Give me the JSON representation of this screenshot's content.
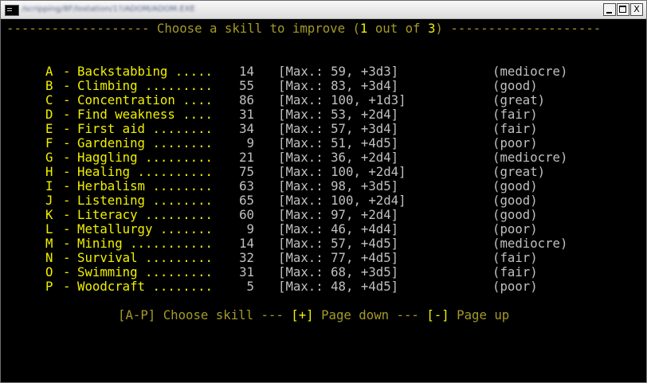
{
  "window": {
    "title": "/scripping/8F/lostation/1?/ADOM/ADOM.EXE",
    "buttons": {
      "minimize": "_",
      "maximize": "□",
      "close": "X"
    }
  },
  "header": {
    "dashes_left": "-------------------",
    "prompt": "Choose a skill to improve (",
    "current": "1",
    "out_of": "out of",
    "total": "3",
    "close_paren": ")",
    "dashes_right": "--------------------"
  },
  "skills": [
    {
      "key": "A",
      "dots": "Backstabbing .....",
      "value": "14",
      "max": "[Max.: 59, +3d3]",
      "rating": "(mediocre)"
    },
    {
      "key": "B",
      "dots": "Climbing .........",
      "value": "55",
      "max": "[Max.: 83, +3d4]",
      "rating": "(good)"
    },
    {
      "key": "C",
      "dots": "Concentration ....",
      "value": "86",
      "max": "[Max.: 100, +1d3]",
      "rating": "(great)"
    },
    {
      "key": "D",
      "dots": "Find weakness ....",
      "value": "31",
      "max": "[Max.: 53, +2d4]",
      "rating": "(fair)"
    },
    {
      "key": "E",
      "dots": "First aid ........",
      "value": "34",
      "max": "[Max.: 57, +3d4]",
      "rating": "(fair)"
    },
    {
      "key": "F",
      "dots": "Gardening ........",
      "value": "9",
      "max": "[Max.: 51, +4d5]",
      "rating": "(poor)"
    },
    {
      "key": "G",
      "dots": "Haggling .........",
      "value": "21",
      "max": "[Max.: 36, +2d4]",
      "rating": "(mediocre)"
    },
    {
      "key": "H",
      "dots": "Healing ..........",
      "value": "75",
      "max": "[Max.: 100, +2d4]",
      "rating": "(great)"
    },
    {
      "key": "I",
      "dots": "Herbalism ........",
      "value": "63",
      "max": "[Max.: 98, +3d5]",
      "rating": "(good)"
    },
    {
      "key": "J",
      "dots": "Listening ........",
      "value": "65",
      "max": "[Max.: 100, +2d4]",
      "rating": "(good)"
    },
    {
      "key": "K",
      "dots": "Literacy .........",
      "value": "60",
      "max": "[Max.: 97, +2d4]",
      "rating": "(good)"
    },
    {
      "key": "L",
      "dots": "Metallurgy .......",
      "value": "9",
      "max": "[Max.: 46, +4d4]",
      "rating": "(poor)"
    },
    {
      "key": "M",
      "dots": "Mining ...........",
      "value": "14",
      "max": "[Max.: 57, +4d5]",
      "rating": "(mediocre)"
    },
    {
      "key": "N",
      "dots": "Survival .........",
      "value": "32",
      "max": "[Max.: 77, +4d5]",
      "rating": "(fair)"
    },
    {
      "key": "O",
      "dots": "Swimming .........",
      "value": "31",
      "max": "[Max.: 68, +3d5]",
      "rating": "(fair)"
    },
    {
      "key": "P",
      "dots": "Woodcraft ........",
      "value": "5",
      "max": "[Max.: 48, +4d5]",
      "rating": "(poor)"
    }
  ],
  "separator": "-",
  "footer": {
    "choose_key": "[A-P]",
    "choose_label": "Choose skill",
    "sep": "---",
    "pgdn_key": "[+]",
    "pgdn_label": "Page down",
    "pgup_key": "[-]",
    "pgup_label": "Page up"
  },
  "colors": {
    "background": "#000000",
    "highlight": "#f0f000",
    "text": "#c0c0c0",
    "dim": "#a49a28"
  }
}
